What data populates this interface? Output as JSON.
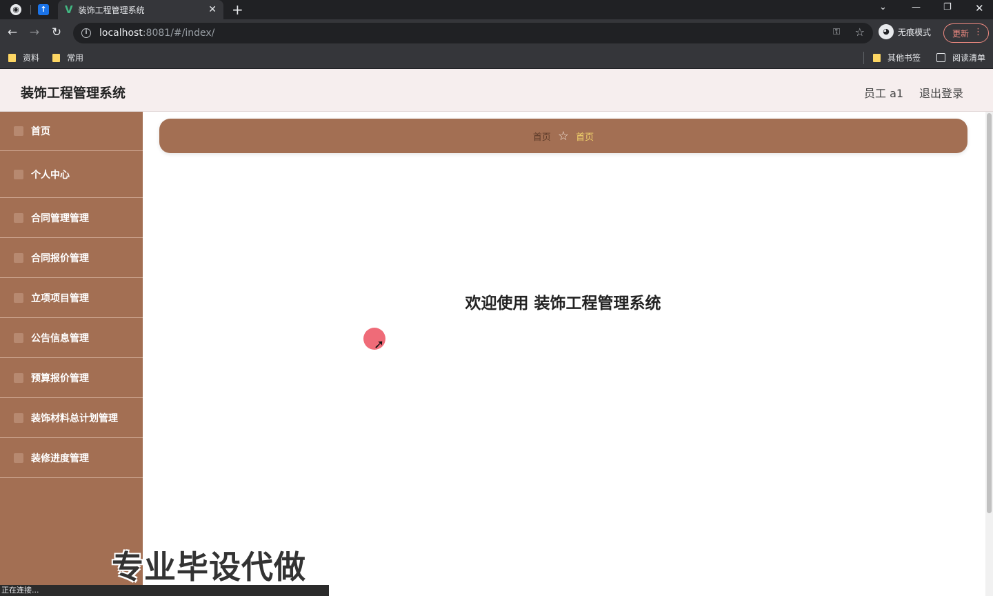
{
  "browser": {
    "tab_title": "装饰工程管理系统",
    "url_host": "localhost",
    "url_path": ":8081/#/index/",
    "incognito_label": "无痕模式",
    "update_label": "更新",
    "bookmarks": [
      {
        "label": "资料"
      },
      {
        "label": "常用"
      }
    ],
    "other_bookmarks": "其他书签",
    "reading_list": "阅读清单",
    "status_text": "正在连接..."
  },
  "header": {
    "title": "装饰工程管理系统",
    "user": "员工 a1",
    "logout": "退出登录"
  },
  "sidebar": {
    "items": [
      {
        "label": "首页",
        "icon": "home-icon"
      },
      {
        "label": "个人中心",
        "icon": "user-icon"
      },
      {
        "label": "合同管理管理",
        "icon": "menu-icon"
      },
      {
        "label": "合同报价管理",
        "icon": "document-icon"
      },
      {
        "label": "立项项目管理",
        "icon": "folder-icon"
      },
      {
        "label": "公告信息管理",
        "icon": "flag-icon"
      },
      {
        "label": "预算报价管理",
        "icon": "menu-icon"
      },
      {
        "label": "装饰材料总计划管理",
        "icon": "grid-icon"
      },
      {
        "label": "装修进度管理",
        "icon": "folder-icon"
      }
    ]
  },
  "breadcrumb": {
    "home": "首页",
    "current": "首页"
  },
  "main": {
    "welcome": "欢迎使用 装饰工程管理系统"
  },
  "overlay": {
    "watermark": "专业毕设代做"
  }
}
